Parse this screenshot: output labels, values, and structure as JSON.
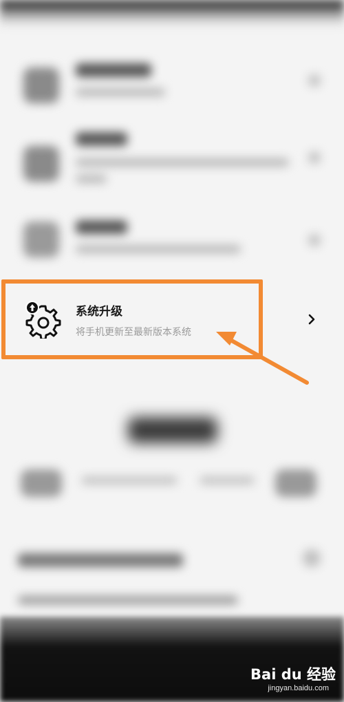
{
  "settings": {
    "system_upgrade": {
      "title": "系统升级",
      "subtitle": "将手机更新至最新版本系统",
      "icon": "gear-upgrade-icon"
    }
  },
  "annotation": {
    "highlight_color": "#f28a33",
    "arrow_color": "#f28a33"
  },
  "watermark": {
    "logo_text": "Bai du 经验",
    "url": "jingyan.baidu.com"
  }
}
